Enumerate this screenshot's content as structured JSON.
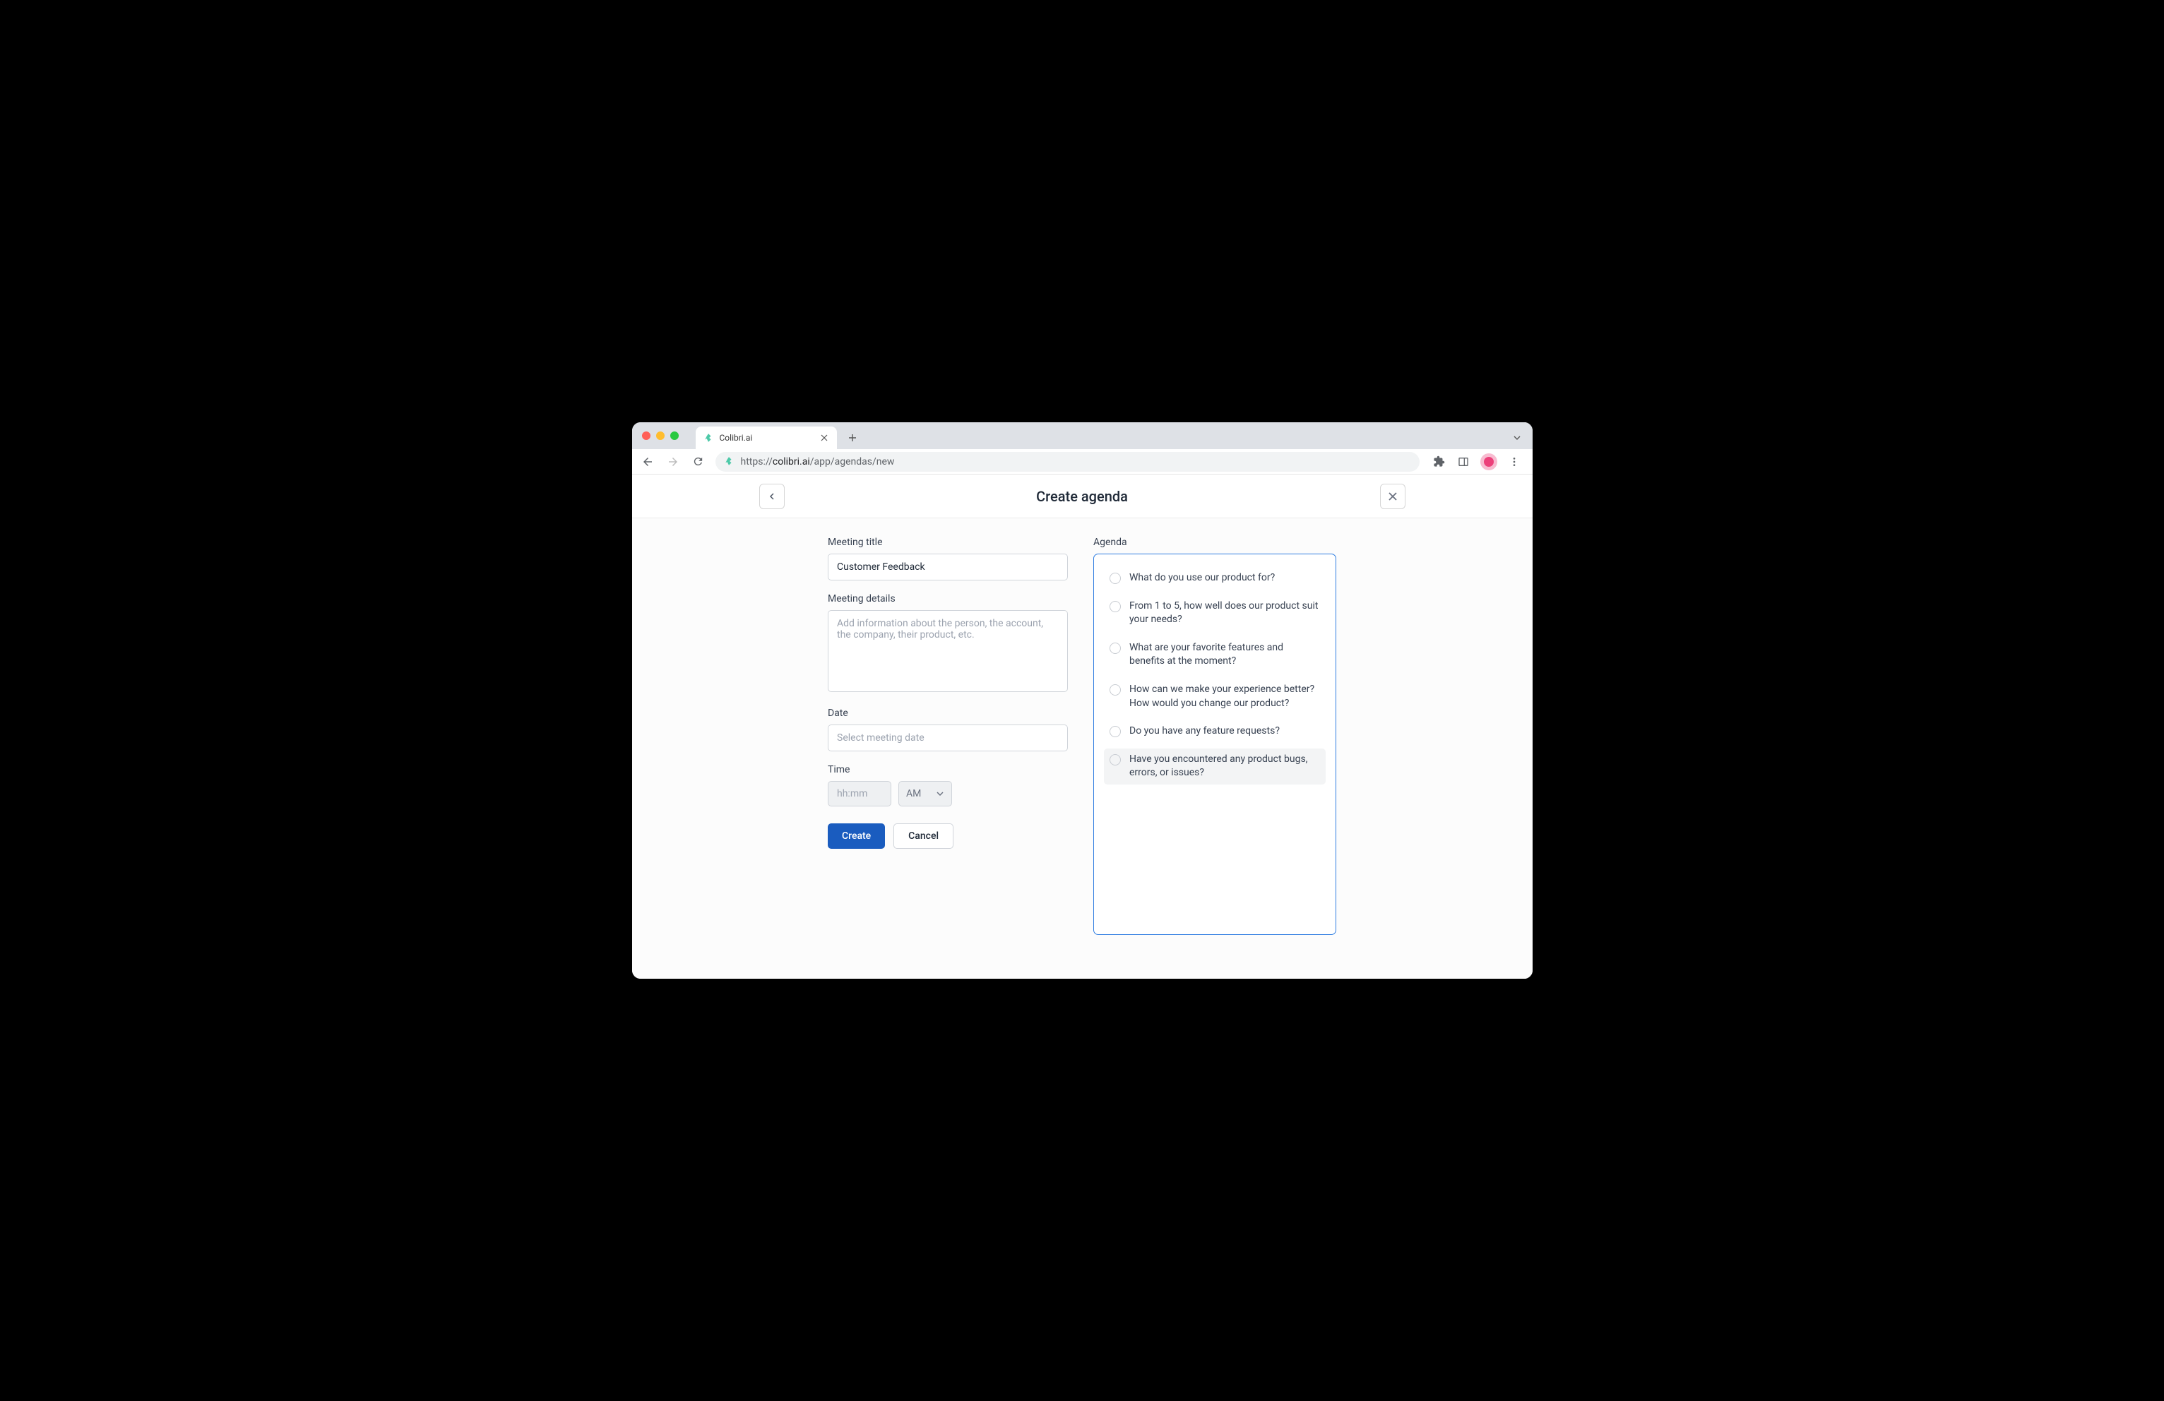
{
  "browser": {
    "tab_title": "Colibri.ai",
    "url_proto": "https://",
    "url_domain": "colibri.ai",
    "url_path": "/app/agendas/new"
  },
  "header": {
    "title": "Create agenda"
  },
  "form": {
    "meeting_title_label": "Meeting title",
    "meeting_title_value": "Customer Feedback",
    "meeting_details_label": "Meeting details",
    "meeting_details_placeholder": "Add information about the person, the account, the company, their product, etc.",
    "meeting_details_value": "",
    "date_label": "Date",
    "date_placeholder": "Select meeting date",
    "date_value": "",
    "time_label": "Time",
    "time_placeholder": "hh:mm",
    "time_value": "",
    "ampm_value": "AM",
    "create_label": "Create",
    "cancel_label": "Cancel"
  },
  "agenda": {
    "label": "Agenda",
    "items": [
      {
        "text": "What do you use our product for?",
        "highlighted": false
      },
      {
        "text": "From 1 to 5, how well does our product suit your needs?",
        "highlighted": false
      },
      {
        "text": "What are your favorite features and benefits at the moment?",
        "highlighted": false
      },
      {
        "text": "How can we make your experience better? How would you change our product?",
        "highlighted": false
      },
      {
        "text": "Do you have any feature requests?",
        "highlighted": false
      },
      {
        "text": "Have you encountered any product bugs, errors, or issues?",
        "highlighted": true
      }
    ]
  }
}
